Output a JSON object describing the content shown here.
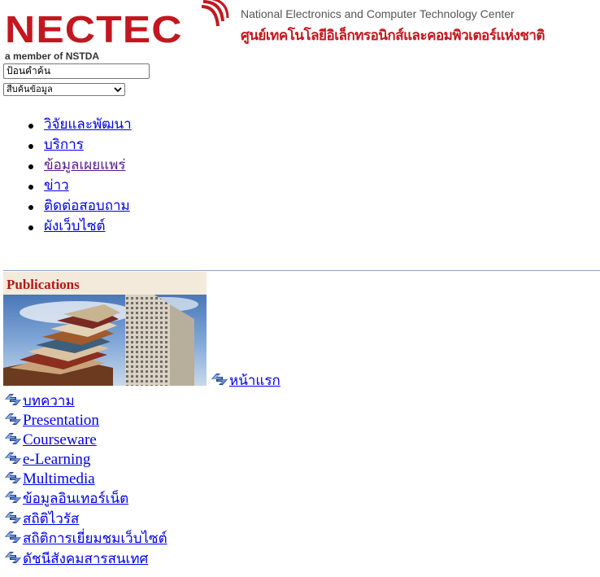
{
  "header": {
    "logo_wordmark": "NECTEC",
    "logo_tagline": "a member of NSTDA",
    "center_name_en": "National Electronics and Computer Technology Center",
    "center_name_th": "ศูนย์เทคโนโลยีอิเล็กทรอนิกส์และคอมพิวเตอร์แห่งชาติ",
    "brand_color": "#c3171f"
  },
  "search": {
    "value": "ป้อนคำค้น",
    "select_selected": "สืบค้นข้อมูล"
  },
  "main_nav": [
    {
      "label": "วิจัยและพัฒนา"
    },
    {
      "label": "บริการ"
    },
    {
      "label": "ข้อมูลเผยแพร่"
    },
    {
      "label": "ข่าว"
    },
    {
      "label": "ติดต่อสอบถาม"
    },
    {
      "label": "ผังเว็บไซต์"
    }
  ],
  "banner": {
    "title": "Publications"
  },
  "pub_links": [
    {
      "label": "หน้าแรก",
      "icon": "recycle-arrows-icon"
    },
    {
      "label": "บทความ",
      "icon": "recycle-arrows-icon"
    },
    {
      "label": "Presentation",
      "icon": "recycle-arrows-icon"
    },
    {
      "label": "Courseware",
      "icon": "recycle-arrows-icon"
    },
    {
      "label": "e-Learning",
      "icon": "recycle-arrows-icon"
    },
    {
      "label": "Multimedia",
      "icon": "recycle-arrows-icon"
    },
    {
      "label": "ข้อมูลอินเทอร์เน็ต",
      "icon": "recycle-arrows-icon"
    },
    {
      "label": "สถิติไวรัส",
      "icon": "recycle-arrows-icon"
    },
    {
      "label": "สถิติการเยี่ยมชมเว็บไซต์",
      "icon": "recycle-arrows-icon"
    },
    {
      "label": "ดัชนีสังคมสารสนเทศ",
      "icon": "recycle-arrows-icon"
    }
  ],
  "colors": {
    "link": "#0000ee",
    "visited": "#551a8b",
    "divider": "#8aa3c4"
  }
}
